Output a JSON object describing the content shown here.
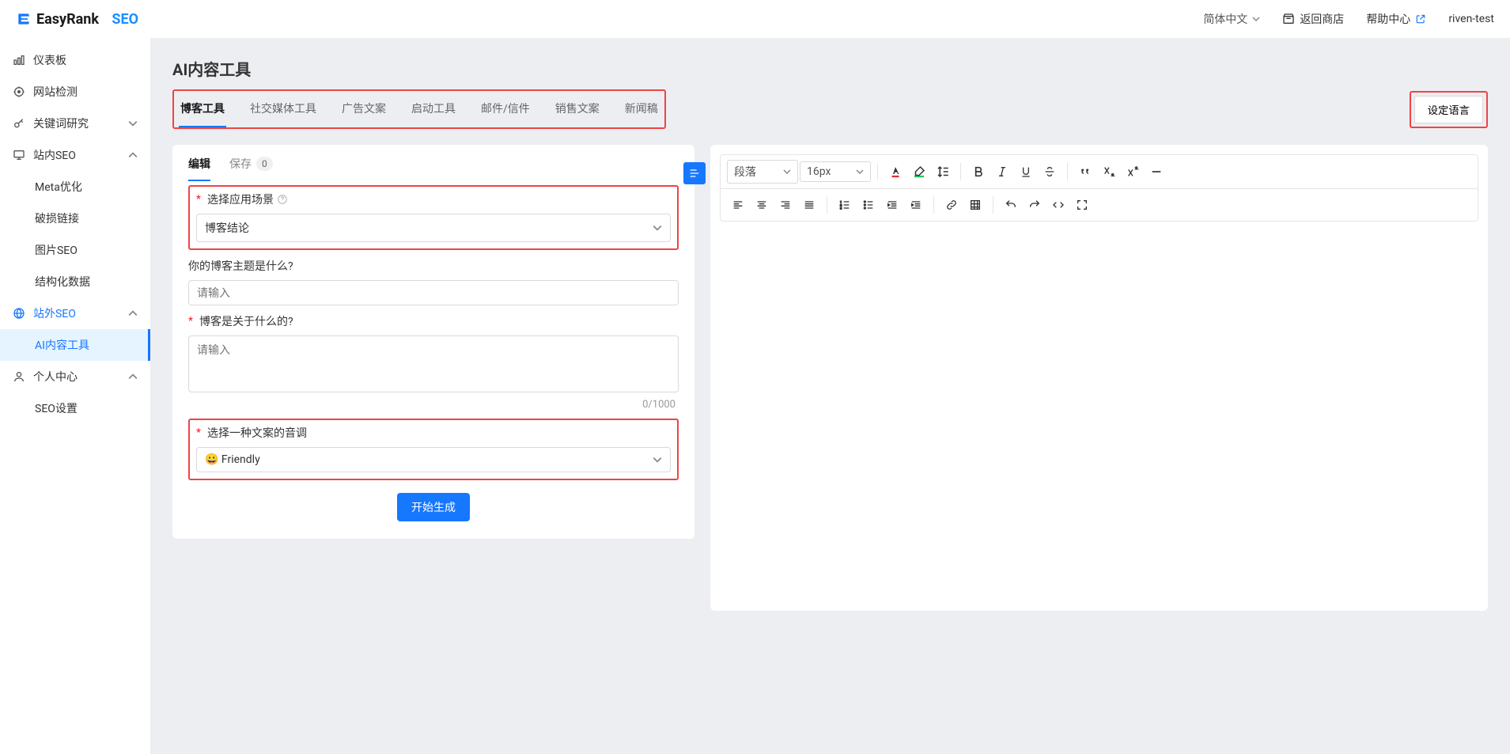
{
  "brand": {
    "name1": "EasyRank",
    "name2": "SEO"
  },
  "header": {
    "lang": "简体中文",
    "back": "返回商店",
    "help": "帮助中心",
    "user": "riven-test"
  },
  "sidebar": {
    "dashboard": "仪表板",
    "site_check": "网站检测",
    "keyword": "关键词研究",
    "onsite": "站内SEO",
    "meta": "Meta优化",
    "broken": "破损链接",
    "imgseo": "图片SEO",
    "structured": "结构化数据",
    "offsite": "站外SEO",
    "ai_tool": "AI内容工具",
    "profile": "个人中心",
    "seo_settings": "SEO设置"
  },
  "page": {
    "title": "AI内容工具",
    "tabs": [
      "博客工具",
      "社交媒体工具",
      "广告文案",
      "启动工具",
      "邮件/信件",
      "销售文案",
      "新闻稿"
    ],
    "set_lang": "设定语言"
  },
  "form": {
    "tab_edit": "编辑",
    "tab_save": "保存",
    "save_count": "0",
    "scene_label": "选择应用场景",
    "scene_value": "博客结论",
    "topic_label": "你的博客主题是什么?",
    "topic_placeholder": "请输入",
    "about_label": "博客是关于什么的?",
    "about_placeholder": "请输入",
    "about_count": "0/1000",
    "tone_label": "选择一种文案的音调",
    "tone_value": "😀 Friendly",
    "submit": "开始生成"
  },
  "editor": {
    "para": "段落",
    "font_size": "16px"
  }
}
